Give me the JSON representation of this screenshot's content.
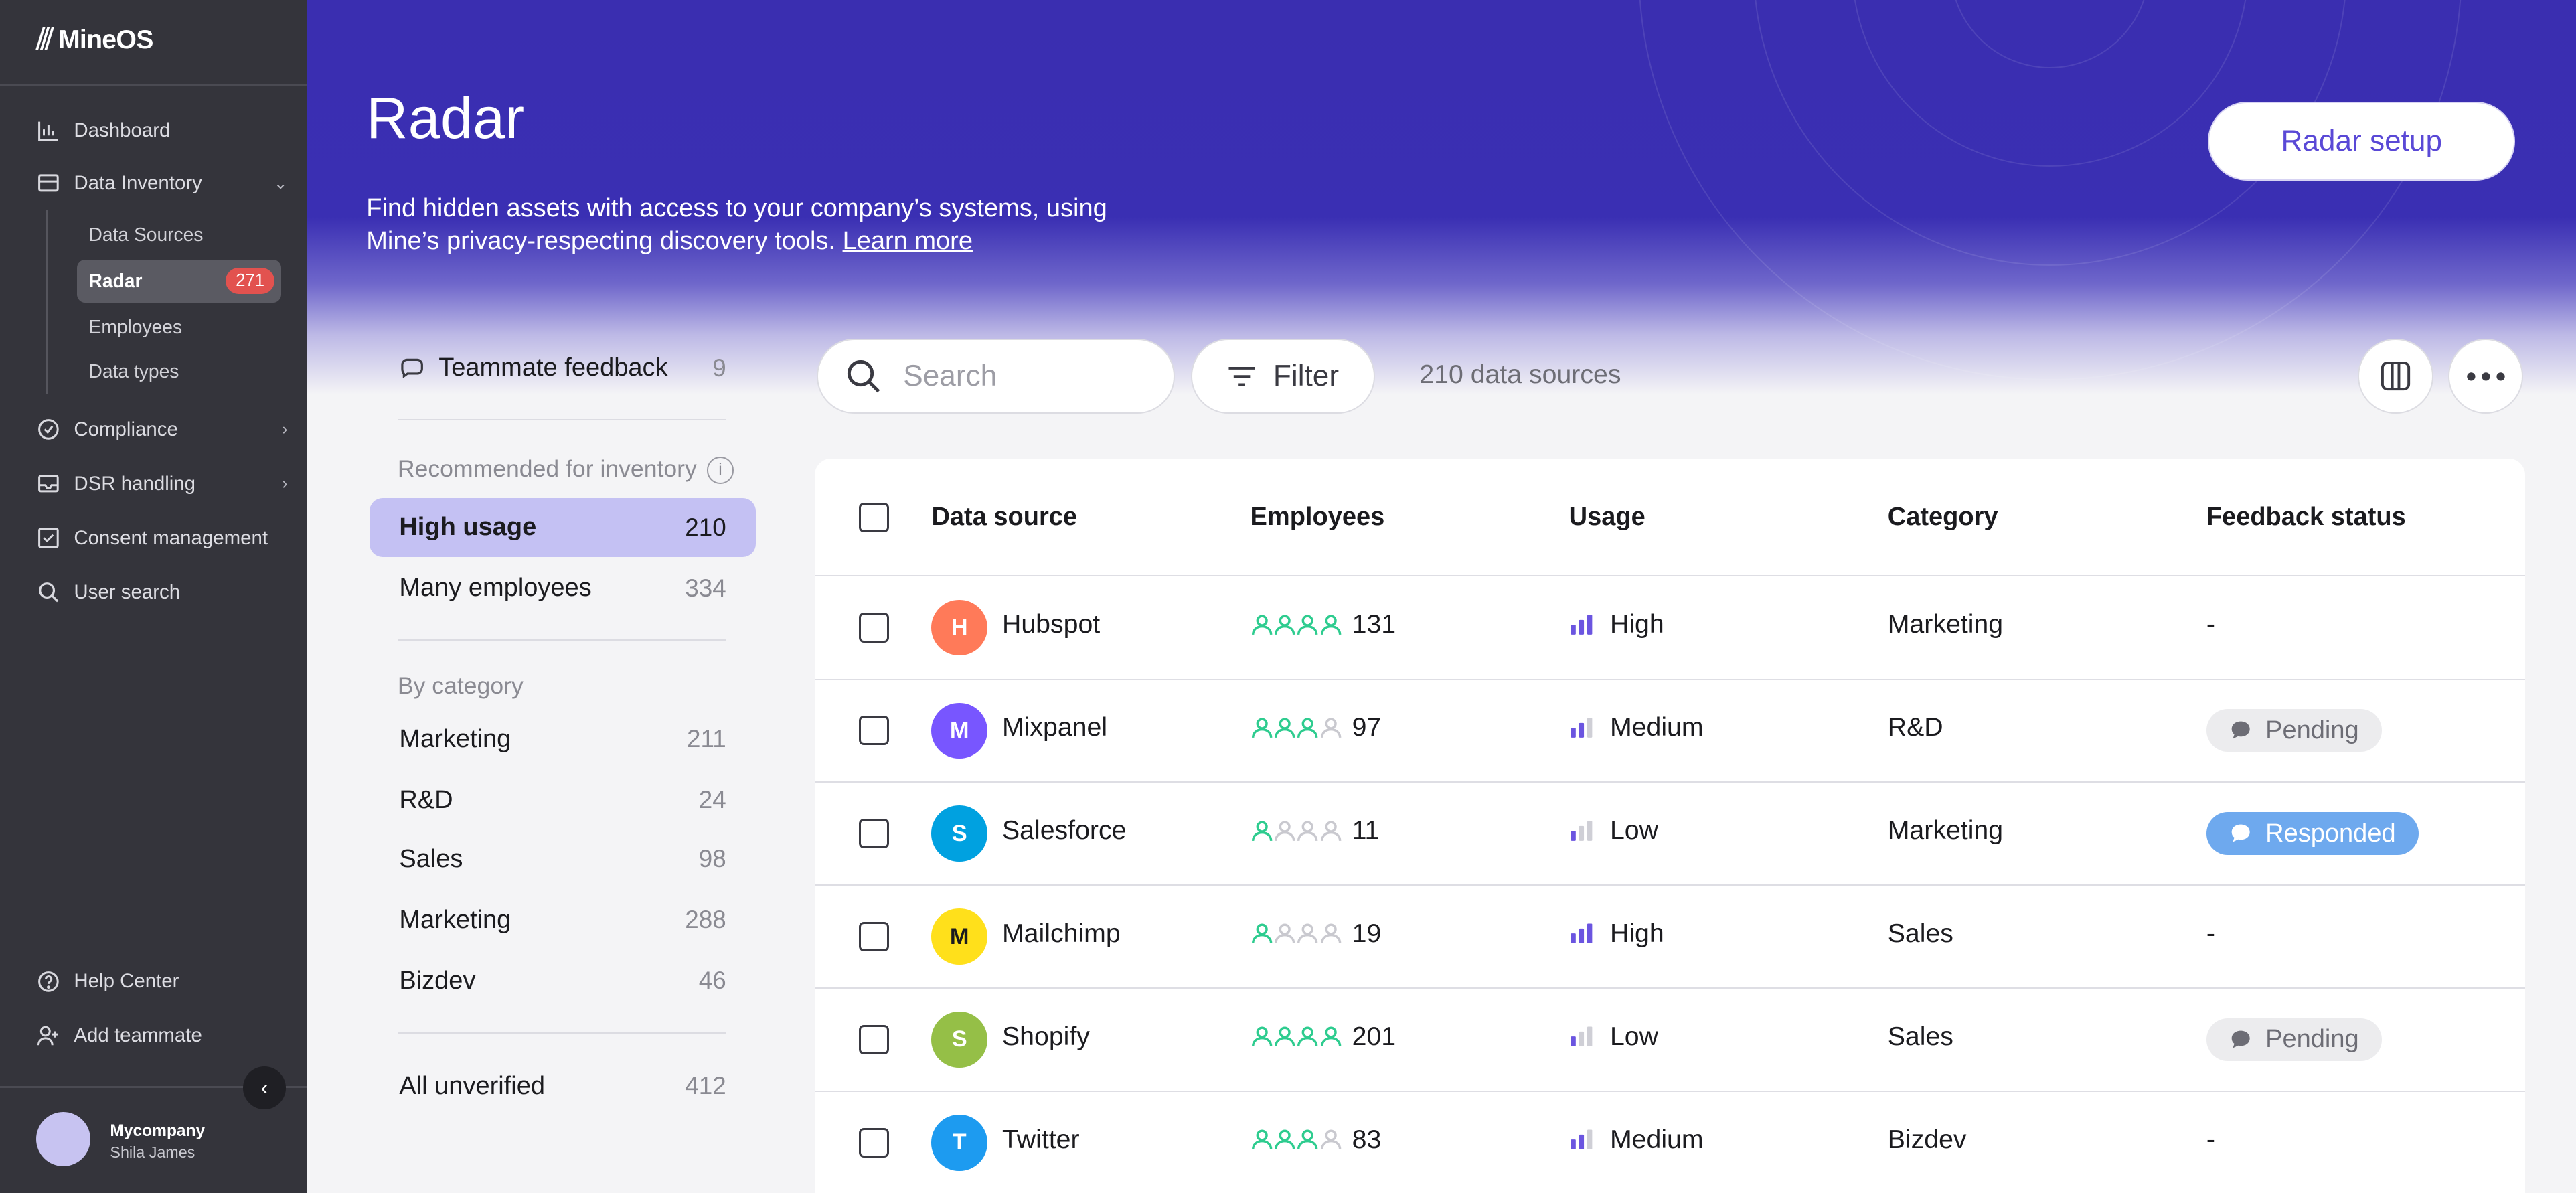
{
  "app": {
    "name": "MineOS"
  },
  "sidebar": {
    "nav": [
      {
        "label": "Dashboard"
      },
      {
        "label": "Data Inventory"
      },
      {
        "label": "Compliance"
      },
      {
        "label": "DSR handling"
      },
      {
        "label": "Consent management"
      },
      {
        "label": "User search"
      }
    ],
    "subnav": [
      {
        "label": "Data Sources"
      },
      {
        "label": "Radar",
        "badge": "271"
      },
      {
        "label": "Employees"
      },
      {
        "label": "Data types"
      }
    ],
    "bottom": [
      {
        "label": "Help Center"
      },
      {
        "label": "Add teammate"
      }
    ],
    "account": {
      "company": "Mycompany",
      "user": "Shila James"
    }
  },
  "header": {
    "title": "Radar",
    "description": "Find hidden assets with access to your company’s systems, using Mine’s privacy-respecting discovery tools.",
    "learn_more": "Learn more",
    "setup_button": "Radar setup"
  },
  "filters": {
    "feedback": {
      "label": "Teammate feedback",
      "count": "9"
    },
    "recommended_heading": "Recommended for inventory",
    "recommended": [
      {
        "label": "High usage",
        "count": "210"
      },
      {
        "label": "Many employees",
        "count": "334"
      }
    ],
    "category_heading": "By category",
    "categories": [
      {
        "label": "Marketing",
        "count": "211"
      },
      {
        "label": "R&D",
        "count": "24"
      },
      {
        "label": "Sales",
        "count": "98"
      },
      {
        "label": "Marketing",
        "count": "288"
      },
      {
        "label": "Bizdev",
        "count": "46"
      }
    ],
    "all_unverified": {
      "label": "All unverified",
      "count": "412"
    }
  },
  "toolbar": {
    "search_placeholder": "Search",
    "filter_label": "Filter",
    "count_label": "210 data sources"
  },
  "table": {
    "columns": [
      "Data source",
      "Employees",
      "Usage",
      "Category",
      "Feedback status"
    ],
    "rows": [
      {
        "name": "Hubspot",
        "employees": "131",
        "emp_level": 4,
        "usage": "High",
        "usage_level": 3,
        "category": "Marketing",
        "feedback": "-",
        "logo_color": "#ff7a59"
      },
      {
        "name": "Mixpanel",
        "employees": "97",
        "emp_level": 3,
        "usage": "Medium",
        "usage_level": 2,
        "category": "R&D",
        "feedback": "Pending",
        "logo_color": "#7856ff"
      },
      {
        "name": "Salesforce",
        "employees": "11",
        "emp_level": 1,
        "usage": "Low",
        "usage_level": 1,
        "category": "Marketing",
        "feedback": "Responded",
        "logo_color": "#00a1e0"
      },
      {
        "name": "Mailchimp",
        "employees": "19",
        "emp_level": 1,
        "usage": "High",
        "usage_level": 3,
        "category": "Sales",
        "feedback": "-",
        "logo_color": "#ffe01b"
      },
      {
        "name": "Shopify",
        "employees": "201",
        "emp_level": 4,
        "usage": "Low",
        "usage_level": 1,
        "category": "Sales",
        "feedback": "Pending",
        "logo_color": "#95bf47"
      },
      {
        "name": "Twitter",
        "employees": "83",
        "emp_level": 3,
        "usage": "Medium",
        "usage_level": 2,
        "category": "Bizdev",
        "feedback": "-",
        "logo_color": "#1d9bf0"
      }
    ]
  },
  "colors": {
    "hero": "#3a2eb0",
    "accent": "#5a49d6",
    "employee_icon": "#2ecc8f",
    "usage_bar": "#6b55e0",
    "badge": "#e2524f",
    "responded": "#6ea9ee"
  }
}
